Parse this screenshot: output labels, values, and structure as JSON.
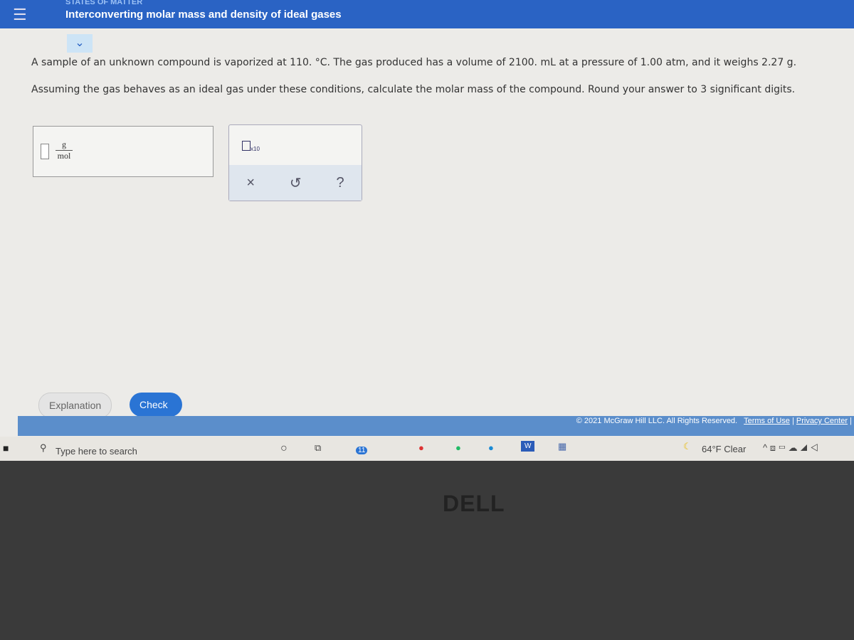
{
  "header": {
    "topic": "STATES OF MATTER",
    "title": "Interconverting molar mass and density of ideal gases"
  },
  "question": {
    "line1": "A sample of an unknown compound is vaporized at 110. °C. The gas produced has a volume of 2100. mL at a pressure of 1.00 atm, and it weighs 2.27 g.",
    "line2": "Assuming the gas behaves as an ideal gas under these conditions, calculate the molar mass of the compound. Round your answer to 3 significant digits."
  },
  "answer": {
    "unit_num": "g",
    "unit_den": "mol",
    "value": ""
  },
  "tools": {
    "x10": "x10",
    "clear": "×",
    "undo": "↺",
    "help": "?"
  },
  "buttons": {
    "explanation": "Explanation",
    "check": "Check"
  },
  "footer": {
    "copyright": "© 2021 McGraw Hill LLC. All Rights Reserved.",
    "terms": "Terms of Use",
    "privacy": "Privacy Center"
  },
  "taskbar": {
    "search_placeholder": "Type here to search",
    "weather": "64°F  Clear",
    "badge": "11"
  },
  "bezel": {
    "brand": "DELL"
  }
}
